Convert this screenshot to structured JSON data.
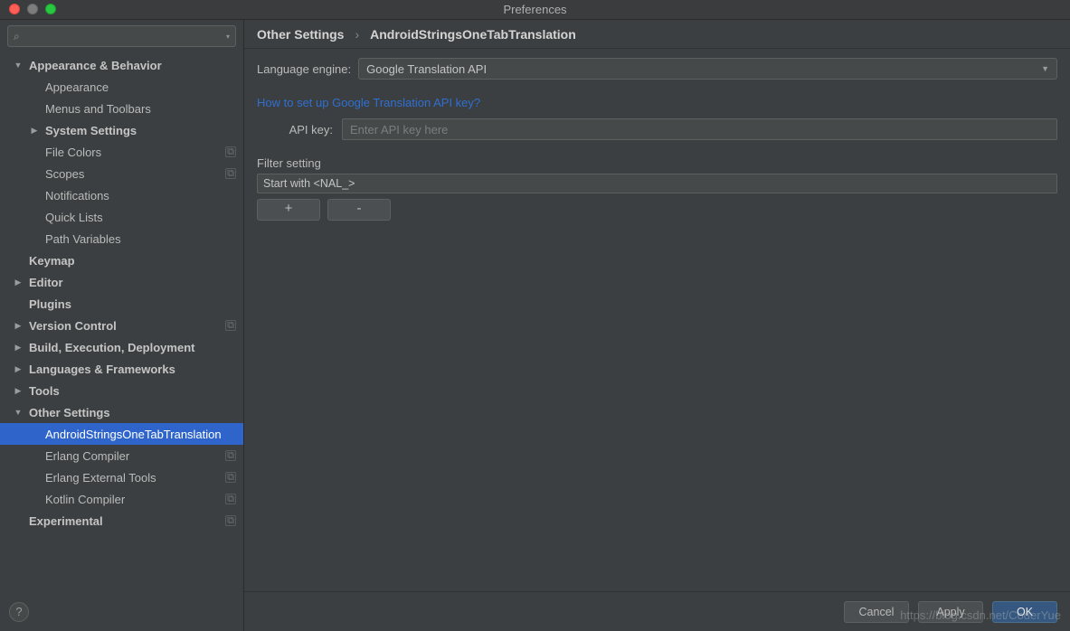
{
  "window_title": "Preferences",
  "search_placeholder": "",
  "tree": [
    {
      "label": "Appearance & Behavior",
      "indent": 0,
      "arrow": "down",
      "bold": true
    },
    {
      "label": "Appearance",
      "indent": 1
    },
    {
      "label": "Menus and Toolbars",
      "indent": 1
    },
    {
      "label": "System Settings",
      "indent": 1,
      "arrow": "right",
      "bold": true
    },
    {
      "label": "File Colors",
      "indent": 1,
      "badge": true
    },
    {
      "label": "Scopes",
      "indent": 1,
      "badge": true
    },
    {
      "label": "Notifications",
      "indent": 1
    },
    {
      "label": "Quick Lists",
      "indent": 1
    },
    {
      "label": "Path Variables",
      "indent": 1
    },
    {
      "label": "Keymap",
      "indent": 0,
      "bold": true
    },
    {
      "label": "Editor",
      "indent": 0,
      "arrow": "right",
      "bold": true
    },
    {
      "label": "Plugins",
      "indent": 0,
      "bold": true
    },
    {
      "label": "Version Control",
      "indent": 0,
      "arrow": "right",
      "bold": true,
      "badge": true
    },
    {
      "label": "Build, Execution, Deployment",
      "indent": 0,
      "arrow": "right",
      "bold": true
    },
    {
      "label": "Languages & Frameworks",
      "indent": 0,
      "arrow": "right",
      "bold": true
    },
    {
      "label": "Tools",
      "indent": 0,
      "arrow": "right",
      "bold": true
    },
    {
      "label": "Other Settings",
      "indent": 0,
      "arrow": "down",
      "bold": true
    },
    {
      "label": "AndroidStringsOneTabTranslation",
      "indent": 1,
      "selected": true
    },
    {
      "label": "Erlang Compiler",
      "indent": 1,
      "badge": true
    },
    {
      "label": "Erlang External Tools",
      "indent": 1,
      "badge": true
    },
    {
      "label": "Kotlin Compiler",
      "indent": 1,
      "badge": true
    },
    {
      "label": "Experimental",
      "indent": 0,
      "bold": true,
      "badge": true
    }
  ],
  "breadcrumb": {
    "a": "Other Settings",
    "sep": "›",
    "b": "AndroidStringsOneTabTranslation"
  },
  "form": {
    "language_engine_label": "Language engine:",
    "language_engine_value": "Google Translation API",
    "setup_link": "How to set up Google Translation API key?",
    "api_key_label": "API key:",
    "api_key_placeholder": "Enter API key here",
    "filter_label": "Filter setting",
    "filter_item": "Start with <NAL_>",
    "add_label": "+",
    "remove_label": "-"
  },
  "buttons": {
    "cancel": "Cancel",
    "apply": "Apply",
    "ok": "OK"
  },
  "help": "?",
  "watermark": "https://blog.csdn.net/CoderYue"
}
